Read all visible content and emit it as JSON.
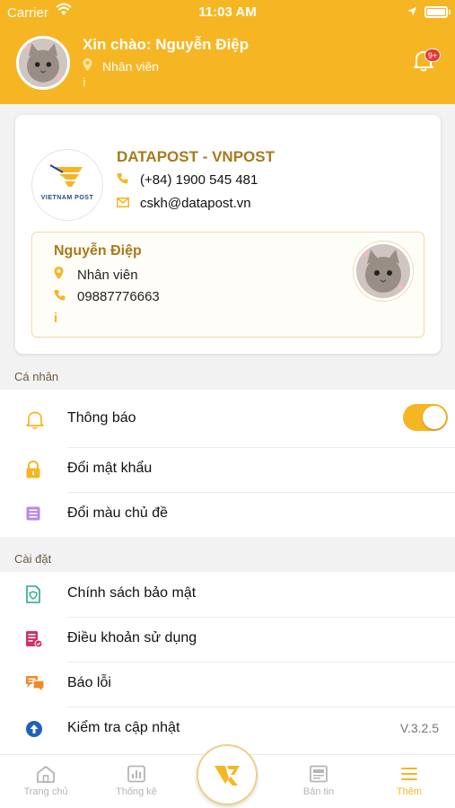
{
  "status_bar": {
    "carrier": "Carrier",
    "time": "11:03 AM"
  },
  "header": {
    "greeting": "Xin chào: Nguyễn Điệp",
    "role": "Nhân viên",
    "notification_badge": "9+",
    "avatar": "cat-avatar"
  },
  "company": {
    "logo_text": "VIETNAM POST",
    "name": "DATAPOST - VNPOST",
    "phone": "(+84) 1900 545 481",
    "email": "cskh@datapost.vn"
  },
  "employee": {
    "name": "Nguyễn Điệp",
    "role": "Nhân viên",
    "phone": "09887776663"
  },
  "personal": {
    "title": "Cá nhân",
    "items": [
      {
        "label": "Thông báo",
        "icon": "bell-icon",
        "toggle": true
      },
      {
        "label": "Đổi mật khẩu",
        "icon": "lock-icon"
      },
      {
        "label": "Đổi màu chủ đề",
        "icon": "theme-icon"
      }
    ]
  },
  "settings": {
    "title": "Cài đặt",
    "items": [
      {
        "label": "Chính sách bảo mật",
        "icon": "shield-doc-icon"
      },
      {
        "label": "Điều khoản sử dụng",
        "icon": "terms-icon"
      },
      {
        "label": "Báo lỗi",
        "icon": "chat-icon"
      },
      {
        "label": "Kiểm tra cập nhật",
        "icon": "upload-icon",
        "version": "V.3.2.5"
      }
    ]
  },
  "tabbar": {
    "tabs": [
      {
        "label": "Trang chủ",
        "icon": "home-icon"
      },
      {
        "label": "Thống kê",
        "icon": "stats-icon"
      },
      {
        "label": "Bản tin",
        "icon": "news-icon"
      },
      {
        "label": "Thêm",
        "icon": "menu-icon",
        "active": true
      }
    ]
  },
  "colors": {
    "accent": "#f6b623",
    "brand_text": "#a87a1a",
    "badge": "#e53935"
  }
}
